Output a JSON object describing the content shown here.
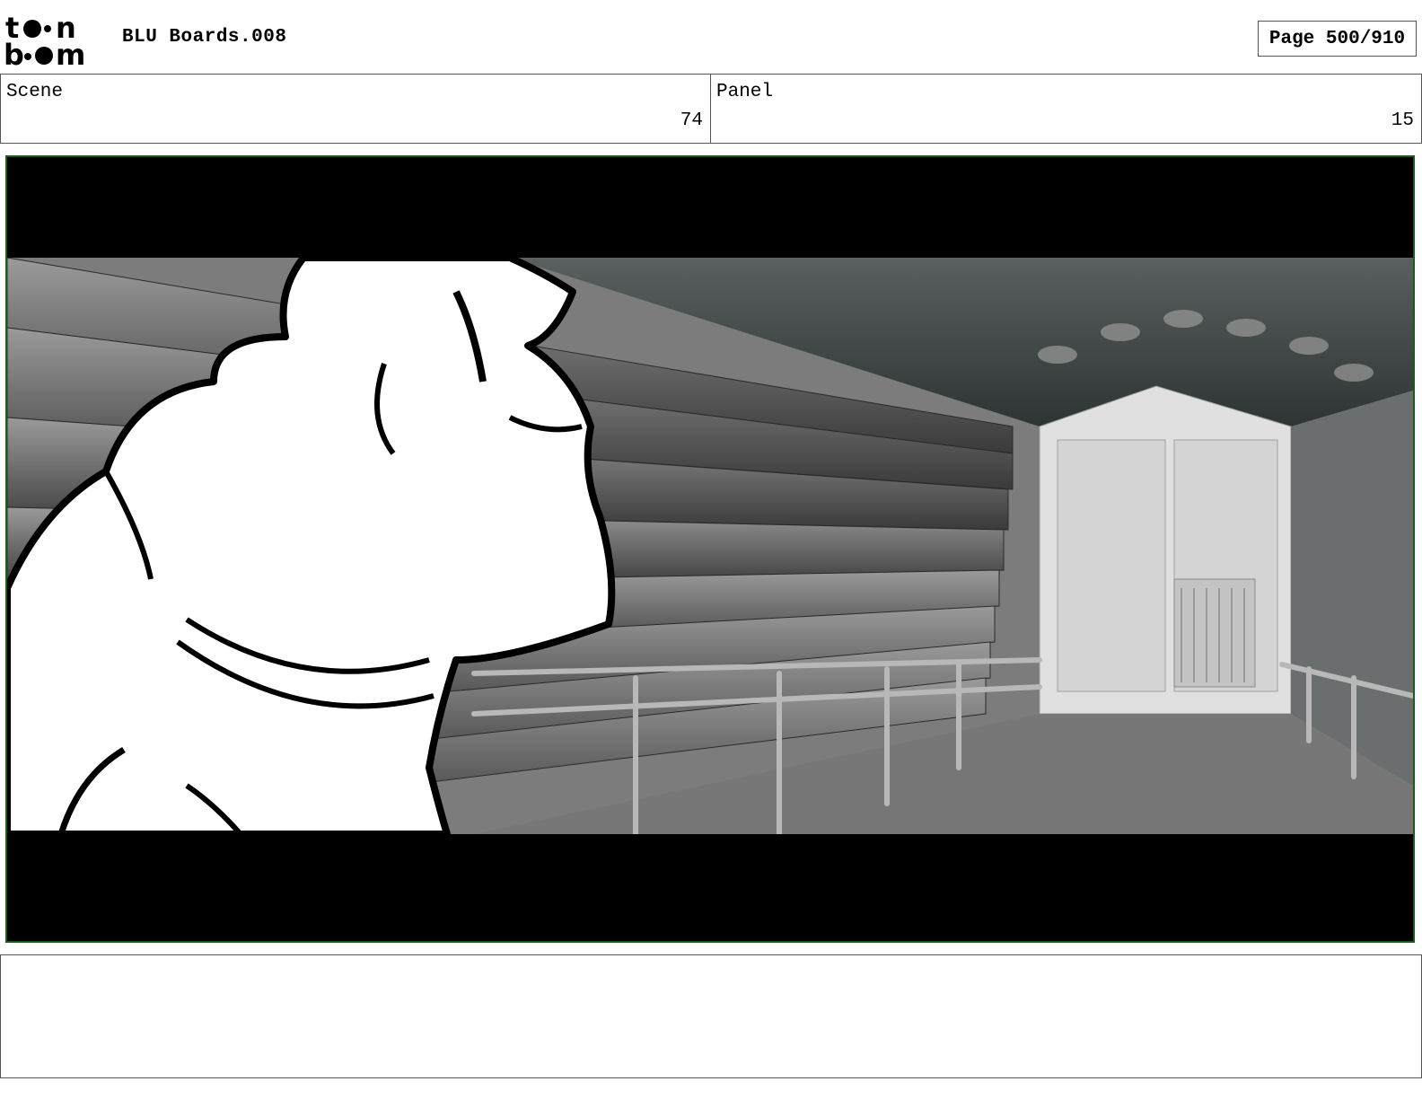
{
  "header": {
    "logo_text_top": "toon",
    "logo_text_bottom": "boom",
    "title": "BLU Boards.008",
    "page": "Page 500/910"
  },
  "scene": {
    "label": "Scene",
    "value": "74"
  },
  "panel": {
    "label": "Panel",
    "value": "15"
  },
  "notes": {
    "text": ""
  }
}
